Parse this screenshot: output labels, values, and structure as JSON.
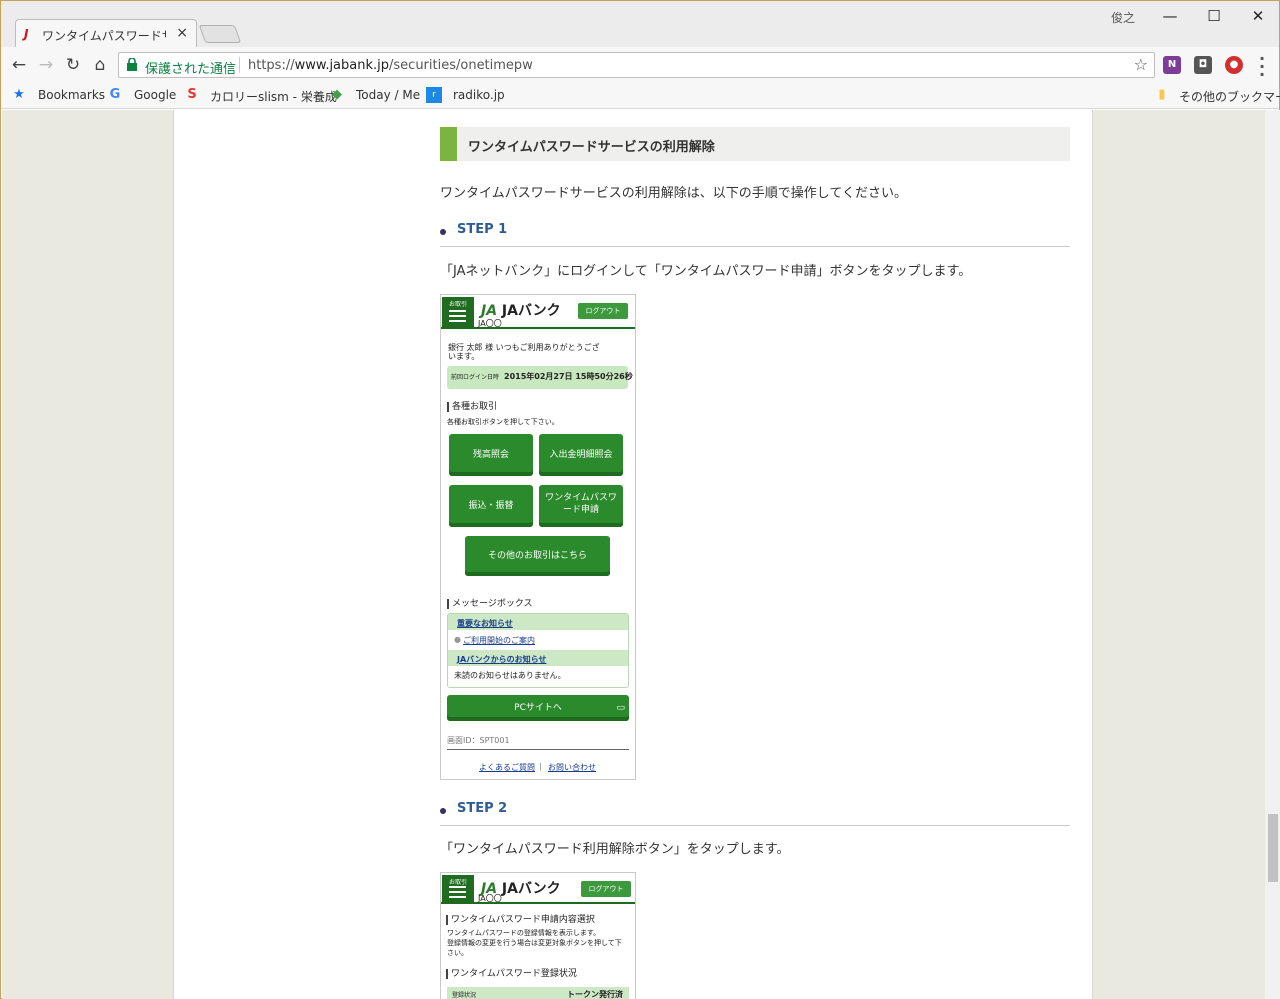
{
  "browser": {
    "tab_title": "ワンタイムパスワードサービス",
    "user": "俊之",
    "secure_label": "保護された通信",
    "url_scheme": "https://",
    "url_host": "www.jabank.jp",
    "url_path": "/securities/onetimepw",
    "bookmarks": [
      {
        "label": "Bookmarks"
      },
      {
        "label": "Google"
      },
      {
        "label": "カロリーslism - 栄養成"
      },
      {
        "label": "Today / Me"
      },
      {
        "label": "radiko.jp"
      }
    ],
    "other_bookmarks": "その他のブックマーク"
  },
  "page": {
    "section_title": "ワンタイムパスワードサービスの利用解除",
    "intro": "ワンタイムパスワードサービスの利用解除は、以下の手順で操作してください。",
    "steps": [
      {
        "label": "STEP 1",
        "desc": "「JAネットバンク」にログインして「ワンタイムパスワード申請」ボタンをタップします。"
      },
      {
        "label": "STEP 2",
        "desc": "「ワンタイムパスワード利用解除ボタン」をタップします。"
      }
    ]
  },
  "phone1": {
    "menu_label": "お取引",
    "logo": "JAバンク",
    "branch": "JA〇〇",
    "logout": "ログアウト",
    "greeting_line1": "銀行 太郎 様 いつもご利用ありがとうござ",
    "greeting_line2": "います。",
    "last_login_label": "前回ログイン日時",
    "last_login_value": "2015年02月27日 15時50分26秒",
    "transactions_heading": "各種お取引",
    "transactions_note": "各種お取引ボタンを押して下さい。",
    "buttons": {
      "balance": "残高照会",
      "statement": "入出金明細照会",
      "transfer": "振込・振替",
      "otp_line1": "ワンタイムパスワ",
      "otp_line2": "ード申請",
      "other": "その他のお取引はこちら"
    },
    "message_heading": "メッセージボックス",
    "important_notice": "重要なお知らせ",
    "notice_item": "ご利用開始のご案内",
    "ja_notice": "JAバンクからのお知らせ",
    "no_unread": "未読のお知らせはありません。",
    "pc_site": "PCサイトへ",
    "screen_id": "画面ID：SPT001",
    "faq": "よくあるご質問",
    "contact": "お問い合わせ"
  },
  "phone2": {
    "menu_label": "お取引",
    "logo": "JAバンク",
    "branch": "JA〇〇",
    "logout": "ログアウト",
    "heading": "ワンタイムパスワード申請内容選択",
    "line1": "ワンタイムパスワードの登録情報を表示します。",
    "line2": "登録情報の変更を行う場合は変更対象ボタンを押して下",
    "line3": "さい。",
    "status_heading": "ワンタイムパスワード登録状況",
    "status_label": "登録状況",
    "status_value": "トークン発行済"
  },
  "colors": {
    "accent_green": "#7cb342",
    "step_blue": "#2f5c92",
    "bank_green": "#2b8a2b"
  }
}
